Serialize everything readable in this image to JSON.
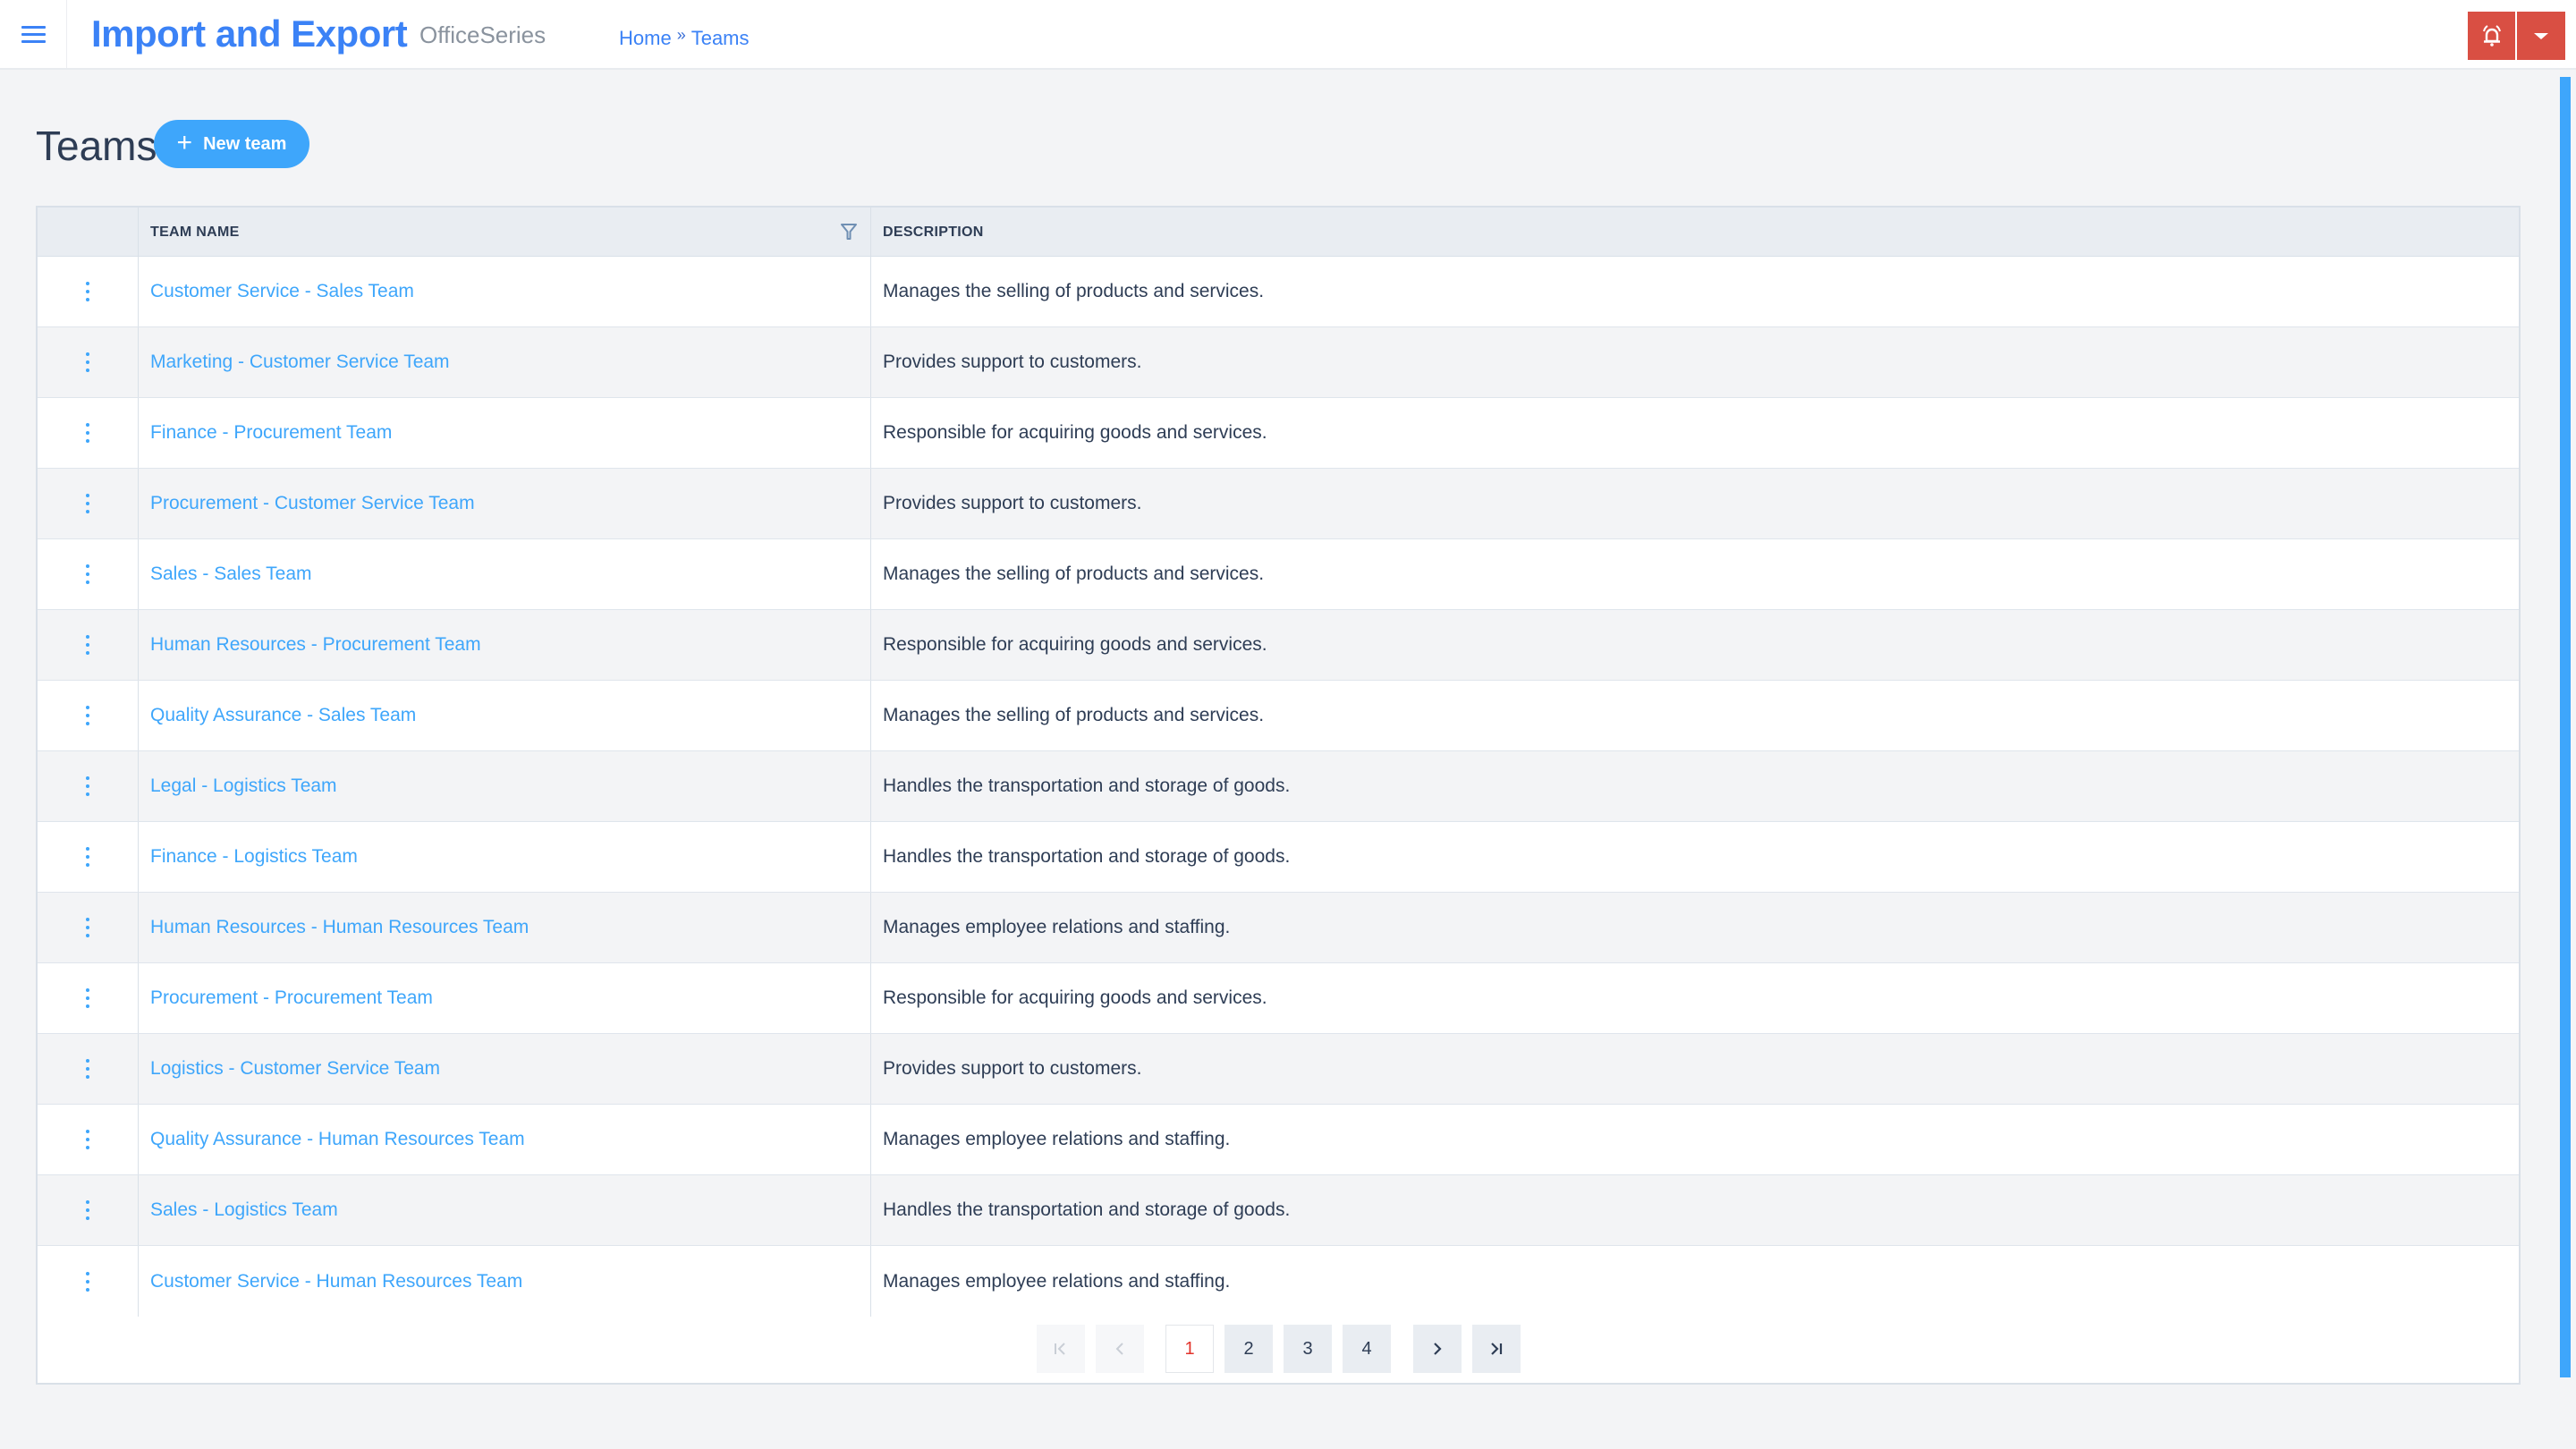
{
  "header": {
    "menu_icon": "hamburger-icon",
    "title": "Import and Export",
    "subtitle": "OfficeSeries",
    "breadcrumb": [
      {
        "label": "Home"
      },
      {
        "label": "Teams"
      }
    ],
    "breadcrumb_separator": "»",
    "alarm_icon": "bell-alarm-icon",
    "menu_caret_icon": "caret-down-icon",
    "accent_color": "#3b82f6",
    "alert_color": "#d94f43"
  },
  "page": {
    "title": "Teams",
    "new_button_label": "New team",
    "new_button_icon": "plus-icon"
  },
  "table": {
    "columns": [
      {
        "key": "actions",
        "label": ""
      },
      {
        "key": "name",
        "label": "TEAM NAME",
        "filter_icon": "filter-icon"
      },
      {
        "key": "description",
        "label": "DESCRIPTION"
      }
    ],
    "row_action_icon": "kebab-menu-icon",
    "rows": [
      {
        "name": "Customer Service - Sales Team",
        "description": "Manages the selling of products and services."
      },
      {
        "name": "Marketing - Customer Service Team",
        "description": "Provides support to customers."
      },
      {
        "name": "Finance - Procurement Team",
        "description": "Responsible for acquiring goods and services."
      },
      {
        "name": "Procurement - Customer Service Team",
        "description": "Provides support to customers."
      },
      {
        "name": "Sales - Sales Team",
        "description": "Manages the selling of products and services."
      },
      {
        "name": "Human Resources - Procurement Team",
        "description": "Responsible for acquiring goods and services."
      },
      {
        "name": "Quality Assurance - Sales Team",
        "description": "Manages the selling of products and services."
      },
      {
        "name": "Legal - Logistics Team",
        "description": "Handles the transportation and storage of goods."
      },
      {
        "name": "Finance - Logistics Team",
        "description": "Handles the transportation and storage of goods."
      },
      {
        "name": "Human Resources - Human Resources Team",
        "description": "Manages employee relations and staffing."
      },
      {
        "name": "Procurement - Procurement Team",
        "description": "Responsible for acquiring goods and services."
      },
      {
        "name": "Logistics - Customer Service Team",
        "description": "Provides support to customers."
      },
      {
        "name": "Quality Assurance - Human Resources Team",
        "description": "Manages employee relations and staffing."
      },
      {
        "name": "Sales - Logistics Team",
        "description": "Handles the transportation and storage of goods."
      },
      {
        "name": "Customer Service - Human Resources Team",
        "description": "Manages employee relations and staffing."
      }
    ]
  },
  "pagination": {
    "first_icon": "first-page-icon",
    "prev_icon": "previous-page-icon",
    "next_icon": "next-page-icon",
    "last_icon": "last-page-icon",
    "pages": [
      "1",
      "2",
      "3",
      "4"
    ],
    "current_page": "1",
    "active_color": "#e2332b"
  }
}
